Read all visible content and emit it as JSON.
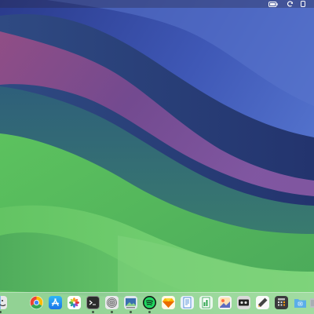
{
  "desktop": {
    "wallpaper": "macOS Sonoma"
  },
  "menubar": {
    "icons": [
      "battery-icon",
      "refresh-icon",
      "phone-mirroring-icon"
    ]
  },
  "dock": {
    "apps": [
      {
        "icon": "finder-icon",
        "running": true
      },
      {
        "icon": "chrome-icon",
        "running": false
      },
      {
        "icon": "app-store-icon",
        "running": false
      },
      {
        "icon": "photos-icon",
        "running": false
      },
      {
        "icon": "terminal-icon",
        "running": true
      },
      {
        "icon": "fingerprint-icon",
        "running": true
      },
      {
        "icon": "preview-icon",
        "running": true
      },
      {
        "icon": "spotify-icon",
        "running": true
      },
      {
        "icon": "sketch-icon",
        "running": false
      },
      {
        "icon": "document-icon",
        "running": false
      },
      {
        "icon": "spreadsheet-icon",
        "running": false
      },
      {
        "icon": "image-editor-icon",
        "running": false
      },
      {
        "icon": "recorder-icon",
        "running": false
      },
      {
        "icon": "pencil-icon",
        "running": false
      },
      {
        "icon": "calculator-icon",
        "running": false
      },
      {
        "icon": "screenshot-folder-icon",
        "running": false
      },
      {
        "icon": "trash-icon",
        "running": false
      }
    ]
  },
  "colors": {
    "sky_top": "#4f6cc4",
    "purple_band": "#8a4a8c",
    "teal": "#2f6a6e",
    "green_light": "#6fc86a",
    "green_mid": "#4fb45a"
  }
}
